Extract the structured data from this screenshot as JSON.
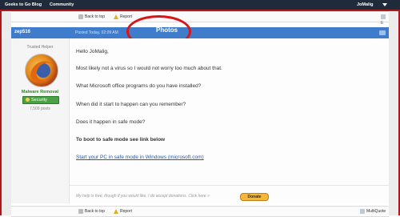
{
  "topnav": {
    "brand": "Geeks to Go Blog",
    "community": "Community",
    "user": "JoMalig"
  },
  "toolbar_top": {
    "back": "Back to top",
    "report": "Report"
  },
  "post": {
    "username": "zep516",
    "time": "Posted Today, 02:09 AM",
    "annotation": "Photos",
    "user_title": "Trusted Helper",
    "badge_label": "Malware Removal",
    "group": "Security",
    "post_count": "7,509 posts",
    "lines": [
      "Hello JoMalig,",
      "Most likely not a virus so I would not worry too much about that.",
      "What Microsoft office programs do you have installed?",
      "When did it start to happen can you remember?",
      "Does it happen in safe mode?"
    ],
    "bold_line": "To boot to safe mode see link below",
    "link_text": "Start your PC in safe mode in Windows (microsoft.com)"
  },
  "signature": {
    "text": "My help is free, though if you would like, I do accept donations. Click here >",
    "button": "Donate"
  },
  "toolbar_bottom": {
    "back": "Back to top",
    "report": "Report",
    "multiquote": "MultiQuote"
  },
  "colors": {
    "topbar": "#1f2b3a",
    "accent_red": "#d8161a",
    "post_header": "#3f7ccc"
  }
}
